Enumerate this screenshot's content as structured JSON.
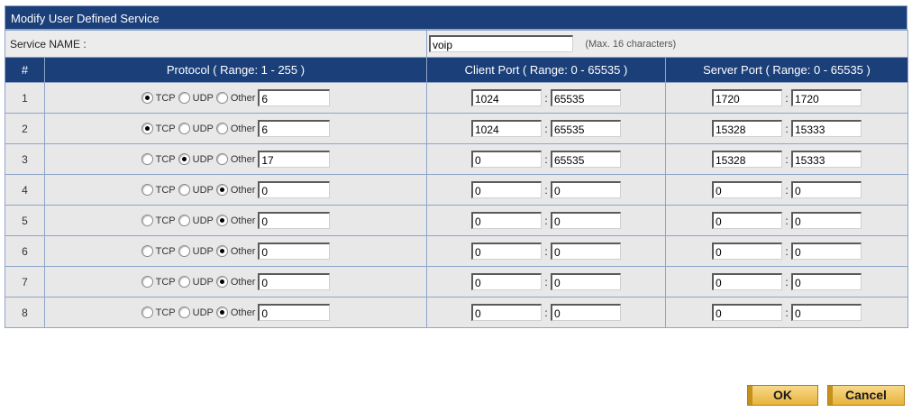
{
  "title": "Modify User Defined Service",
  "service_name": {
    "label": "Service NAME :",
    "value": "voip",
    "hint": "(Max. 16 characters)"
  },
  "headers": {
    "num": "#",
    "protocol": "Protocol ( Range: 1 - 255 )",
    "client": "Client Port ( Range: 0 - 65535 )",
    "server": "Server Port ( Range: 0 - 65535 )"
  },
  "protocol_labels": {
    "tcp": "TCP",
    "udp": "UDP",
    "other": "Other"
  },
  "rows": [
    {
      "num": "1",
      "protocol": "TCP",
      "other": "6",
      "client_from": "1024",
      "client_to": "65535",
      "server_from": "1720",
      "server_to": "1720"
    },
    {
      "num": "2",
      "protocol": "TCP",
      "other": "6",
      "client_from": "1024",
      "client_to": "65535",
      "server_from": "15328",
      "server_to": "15333"
    },
    {
      "num": "3",
      "protocol": "UDP",
      "other": "17",
      "client_from": "0",
      "client_to": "65535",
      "server_from": "15328",
      "server_to": "15333"
    },
    {
      "num": "4",
      "protocol": "Other",
      "other": "0",
      "client_from": "0",
      "client_to": "0",
      "server_from": "0",
      "server_to": "0"
    },
    {
      "num": "5",
      "protocol": "Other",
      "other": "0",
      "client_from": "0",
      "client_to": "0",
      "server_from": "0",
      "server_to": "0"
    },
    {
      "num": "6",
      "protocol": "Other",
      "other": "0",
      "client_from": "0",
      "client_to": "0",
      "server_from": "0",
      "server_to": "0"
    },
    {
      "num": "7",
      "protocol": "Other",
      "other": "0",
      "client_from": "0",
      "client_to": "0",
      "server_from": "0",
      "server_to": "0"
    },
    {
      "num": "8",
      "protocol": "Other",
      "other": "0",
      "client_from": "0",
      "client_to": "0",
      "server_from": "0",
      "server_to": "0"
    }
  ],
  "buttons": {
    "ok": "OK",
    "cancel": "Cancel"
  },
  "colors": {
    "header_bg": "#1b3f79",
    "row_bg": "#e8e8e8",
    "button_bg": "#e8b33a"
  }
}
